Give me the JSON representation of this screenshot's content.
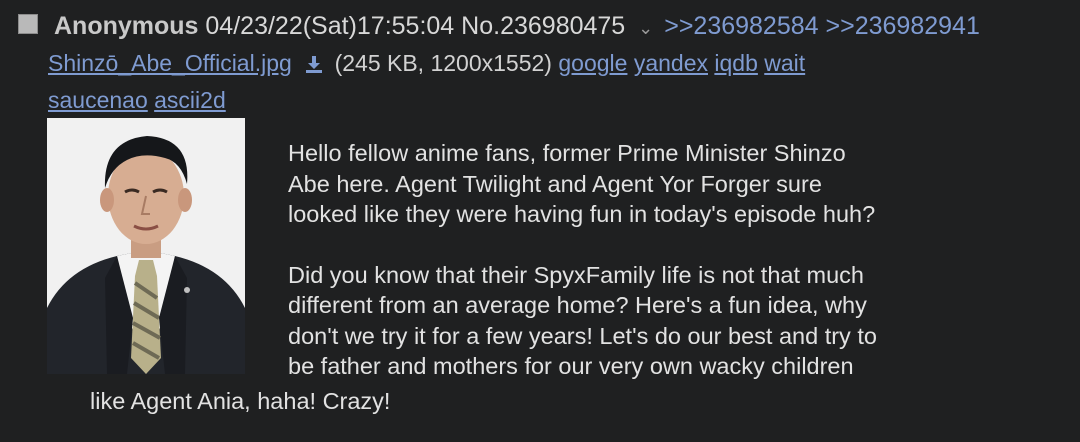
{
  "post": {
    "name": "Anonymous",
    "datetime": "04/23/22(Sat)17:55:04",
    "number": "No.236980475",
    "chevron": "⌄",
    "replies": [
      ">>236982584",
      ">>236982941"
    ]
  },
  "file": {
    "filename": "Shinzō_Abe_Official.jpg",
    "meta": "(245 KB, 1200x1552)",
    "search_links": [
      "google",
      "yandex",
      "iqdb",
      "wait",
      "saucenao",
      "ascii2d"
    ]
  },
  "message": {
    "p1_lines": [
      "Hello fellow anime fans, former Prime Minister Shinzo",
      "Abe here. Agent Twilight and Agent Yor Forger sure",
      "looked like they were having fun in today's episode huh?"
    ],
    "p2_lines": [
      "Did you know that their SpyxFamily life is not that much",
      "different from an average home? Here's a fun idea, why",
      "don't we try it for a few years! Let's do our best and try to",
      "be father and mothers for our very own wacky children"
    ],
    "tail_line": "like Agent Ania, haha! Crazy!"
  },
  "icons": {
    "checkbox": "checkbox-icon",
    "download": "download-icon",
    "chevron": "chevron-down-icon"
  },
  "colors": {
    "background": "#1f2021",
    "link": "#7f9bd1",
    "text": "#e2e2e2"
  }
}
